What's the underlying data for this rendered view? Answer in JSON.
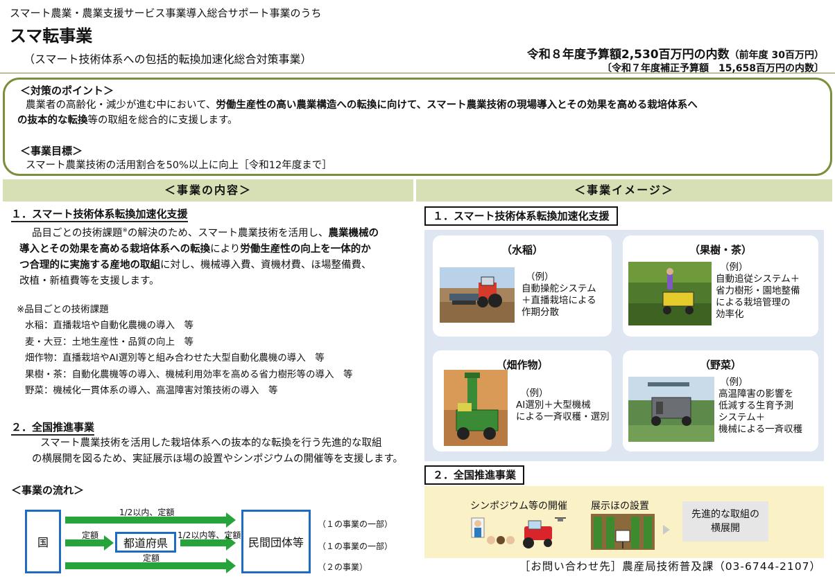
{
  "header": {
    "subtitle": "スマート農業・農業支援サービス事業導入総合サポート事業のうち",
    "title": "スマ転事業",
    "paren": "（スマート技術体系への包括的転換加速化総合対策事業）",
    "budget_main": "令和８年度予算額2,530百万円の内数",
    "budget_prev": "（前年度 30百万円）",
    "budget_supp": "〔令和７年度補正予算額　15,658百万円の内数〕"
  },
  "points": {
    "heading": "＜対策のポイント＞",
    "line1_a": "農業者の高齢化・減少が進む中において、",
    "line1_b": "労働生産性の高い農業構造への転換に向けて、スマート農業技術の現場導入とその効果を高める栽培体系へ",
    "line2_a": "の抜本的な転換",
    "line2_b": "等の取組を総合的に支援します。",
    "goal_heading": "＜事業目標＞",
    "goal_text": "スマート農業技術の活用割合を50%以上に向上［令和12年度まで］"
  },
  "sections": {
    "content": "＜事業の内容＞",
    "image": "＜事業イメージ＞"
  },
  "content": {
    "h1": "１．スマート技術体系転換加速化支援",
    "p1_l1a": "品目ごとの技術課題",
    "p1_l1sup": "※",
    "p1_l1b": "の解決のため、スマート農業技術を活用し、",
    "p1_l1c": "農業機械の",
    "p1_l2a": "導入とその効果を高める栽培体系への転換",
    "p1_l2b": "により",
    "p1_l2c": "労働生産性の向上を一体的か",
    "p1_l3a": "つ合理的に実施する産地の取組",
    "p1_l3b": "に対し、機械導入費、資機材費、ほ場整備費、",
    "p1_l4": "改植・新植費等を支援します。",
    "note_heading": "※品目ごとの技術課題",
    "notes": [
      "水稲：直播栽培や自動化農機の導入　等",
      "麦・大豆：土地生産性・品質の向上　等",
      "畑作物：直播栽培やAI選別等と組み合わせた大型自動化農機の導入　等",
      "果樹・茶：自動化農機等の導入、機械利用効率を高める省力樹形等の導入　等",
      "野菜：機械化一貫体系の導入、高温障害対策技術の導入　等"
    ],
    "h2": "２．全国推進事業",
    "p2_l1": "スマート農業技術を活用した栽培体系への抜本的な転換を行う先進的な取組",
    "p2_l2": "の横展開を図るため、実証展示ほ場の設置やシンポジウムの開催等を支援します。",
    "flow_heading": "＜事業の流れ＞",
    "flow": {
      "country": "国",
      "prefecture": "都道府県",
      "private": "民間団体等",
      "arrow1": "1/2以内、定額",
      "arrow2a": "定額",
      "arrow2b": "1/2以内等、定額",
      "arrow3": "定額",
      "note1": "（１の事業の一部）",
      "note2": "（１の事業の一部）",
      "note3": "（２の事業）"
    }
  },
  "image": {
    "label1": "１．スマート技術体系転換加速化支援",
    "cards": [
      {
        "title": "（水稲）",
        "lines": [
          "（例）",
          "自動操舵システム",
          "＋直播栽培による",
          "作期分散"
        ]
      },
      {
        "title": "（果樹・茶）",
        "lines": [
          "（例）",
          "自動追従システム＋",
          "省力樹形・園地整備",
          "による栽培管理の",
          "効率化"
        ]
      },
      {
        "title": "（畑作物）",
        "lines": [
          "（例）",
          "AI選別＋大型機械",
          "による一斉収穫・選別"
        ]
      },
      {
        "title": "（野菜）",
        "lines": [
          "（例）",
          "高温障害の影響を",
          "低減する生育予測",
          "システム＋",
          "機械による一斉収穫"
        ]
      }
    ],
    "label2": "２．全国推進事業",
    "symposium": "シンポジウム等の開催",
    "demo": "展示ほの設置",
    "demo_sign": "スマート\n展示ほ",
    "spread": "先進的な取組の\n横展開"
  },
  "contact": "［お問い合わせ先］農産局技術普及課（03-6744-2107）",
  "colors": {
    "frame_green": "#7b8e3b",
    "section_bar": "#d7dfb4",
    "flow_blue": "#1f6bc1",
    "arrow_green": "#27a33c",
    "image_panel": "#dde6f1",
    "national_panel": "#fbf1c7"
  }
}
